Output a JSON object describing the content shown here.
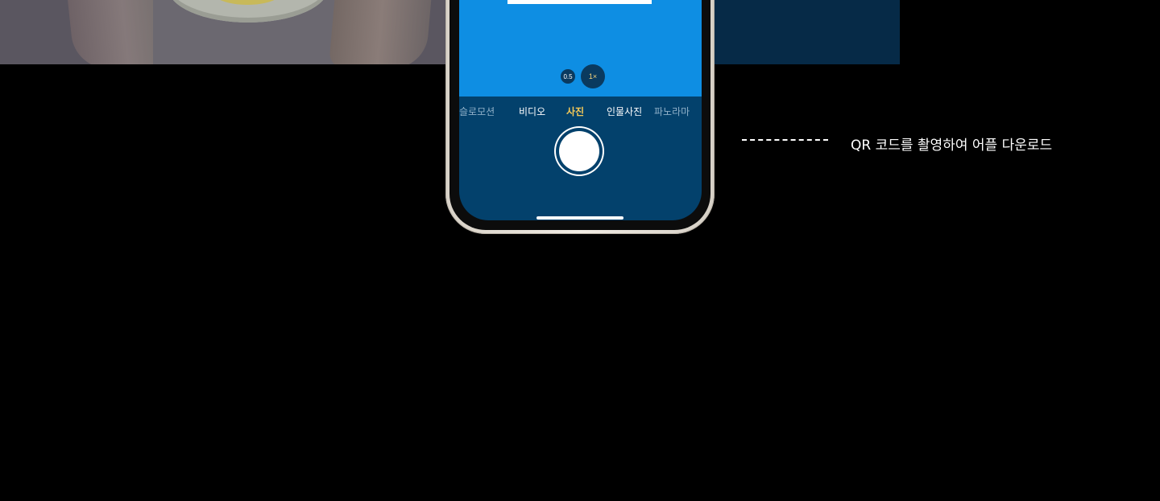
{
  "camera": {
    "zoom_options": [
      "0.5",
      "1×"
    ],
    "modes": [
      "슬로모션",
      "비디오",
      "사진",
      "인물사진",
      "파노라마"
    ],
    "active_mode": "사진"
  },
  "callout": {
    "text": "QR 코드를 촬영하여 어플 다운로드"
  },
  "colors": {
    "viewfinder": "#0e8ee3",
    "screen_bottom": "#03416c",
    "active_mode": "#f5c957",
    "background": "#000000"
  }
}
